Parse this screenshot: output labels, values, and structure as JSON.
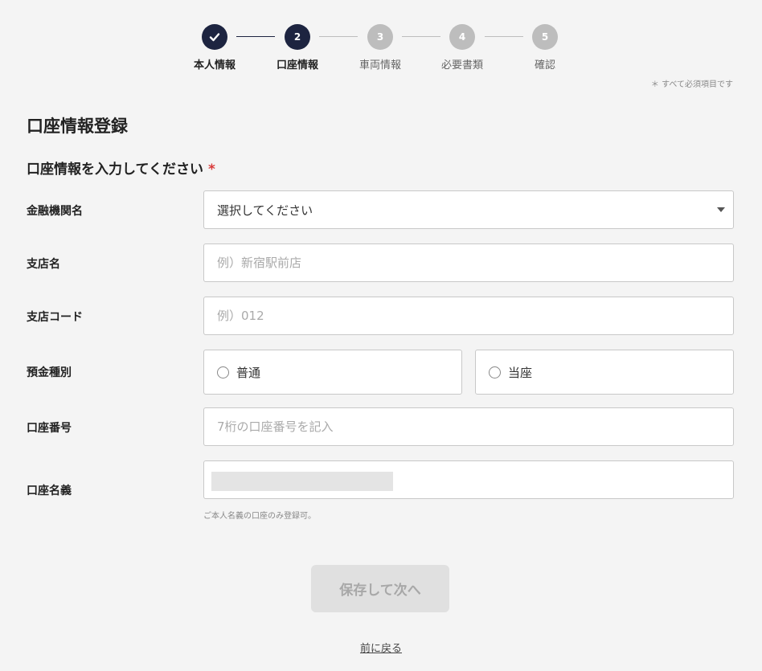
{
  "stepper": {
    "steps": [
      {
        "number": "",
        "label": "本人情報",
        "state": "done"
      },
      {
        "number": "2",
        "label": "口座情報",
        "state": "current"
      },
      {
        "number": "3",
        "label": "車両情報",
        "state": "todo"
      },
      {
        "number": "4",
        "label": "必要書類",
        "state": "todo"
      },
      {
        "number": "5",
        "label": "確認",
        "state": "todo"
      }
    ],
    "required_note": "＊ すべて必須項目です"
  },
  "page_title": "口座情報登録",
  "section_title": "口座情報を入力してください",
  "required_mark": "*",
  "form": {
    "bank": {
      "label": "金融機関名",
      "value": "選択してください"
    },
    "branch_name": {
      "label": "支店名",
      "placeholder": "例）新宿駅前店"
    },
    "branch_code": {
      "label": "支店コード",
      "placeholder": "例）012"
    },
    "account_type": {
      "label": "預金種別",
      "options": [
        {
          "label": "普通",
          "selected": false
        },
        {
          "label": "当座",
          "selected": false
        }
      ]
    },
    "account_number": {
      "label": "口座番号",
      "placeholder": "7桁の口座番号を記入"
    },
    "account_holder": {
      "label": "口座名義",
      "hint": "ご本人名義の口座のみ登録可。"
    }
  },
  "actions": {
    "submit_label": "保存して次へ",
    "back_label": "前に戻る"
  },
  "colors": {
    "primary": "#1d2440",
    "inactive_step": "#bdbdbd",
    "required": "#d93a3a",
    "disabled_button_bg": "#e0e0e0",
    "disabled_button_text": "#a8a8a8"
  },
  "icons": {
    "completed_step": "check-icon",
    "select": "chevron-down-icon",
    "radio": "radio-circle-icon"
  }
}
